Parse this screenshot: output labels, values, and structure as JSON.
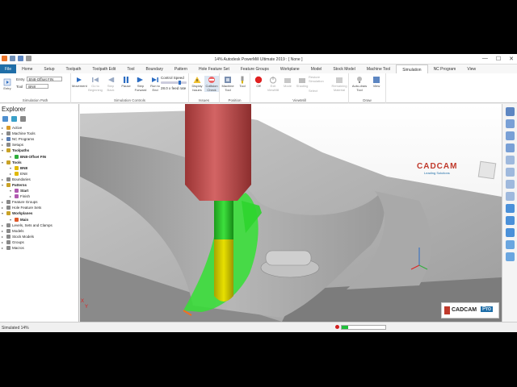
{
  "window": {
    "title": "14% Autodesk PowerMill Ultimate 2019  :  [ None ]"
  },
  "tabs": [
    "File",
    "Home",
    "Setup",
    "Toolpath",
    "Toolpath Edit",
    "Tool",
    "Boundary",
    "Pattern",
    "Hole Feature Set",
    "Feature Groups",
    "Workplane",
    "Model",
    "Stock Model",
    "Machine Tool",
    "Simulation",
    "NC Program",
    "View"
  ],
  "active_tab": "Simulation",
  "ribbon": {
    "simulation_path": {
      "entry_label": "Entry",
      "entry_value": "BN8-Offset FIN",
      "tool_label": "Tool",
      "tool_value": "BN8",
      "entry_btn": "Entry",
      "group_label": "Simulation Path"
    },
    "simulation_controls": {
      "movement": "Movement",
      "go_to_beginning": "Go to Beginning",
      "step_back": "Step Back",
      "pause": "Pause",
      "step_forward": "Step Forward",
      "run_to_end": "Run to End",
      "control_speed": "Control Speed",
      "feed_rate": "28.0 x feed rate",
      "group_label": "Simulation Controls"
    },
    "issues": {
      "display_issues": "Display Issues",
      "collision_check": "Collision Check",
      "group_label": "Issues"
    },
    "position": {
      "machine_tool": "Machine Tool",
      "tool": "Tool",
      "group_label": "Position"
    },
    "viewmill": {
      "off": "Off",
      "exit_viewmill": "Exit ViewMill",
      "mode": "Mode",
      "shading": "Shading",
      "restore_simulation": "Restore Simulation",
      "select": "Select",
      "remaining_material": "Remaining Material",
      "group_label": "ViewMill"
    },
    "draw": {
      "auto_draw_tool": "Auto-draw Tool",
      "view": "View",
      "group_label": "Draw"
    }
  },
  "explorer": {
    "title": "Explorer",
    "items": [
      {
        "label": "Active",
        "indent": 0,
        "bold": false,
        "color": "#d89a2a"
      },
      {
        "label": "Machine Tools",
        "indent": 0,
        "bold": false,
        "color": "#8a8a8a"
      },
      {
        "label": "NC Programs",
        "indent": 0,
        "bold": false,
        "color": "#5a7fb5"
      },
      {
        "label": "Setups",
        "indent": 0,
        "bold": false,
        "color": "#8a8a8a"
      },
      {
        "label": "Toolpaths",
        "indent": 0,
        "bold": true,
        "color": "#c9a227"
      },
      {
        "label": "BN8-Offset FIN",
        "indent": 1,
        "bold": true,
        "color": "#2fae3b"
      },
      {
        "label": "Tools",
        "indent": 0,
        "bold": true,
        "color": "#c9a227"
      },
      {
        "label": "BN8",
        "indent": 1,
        "bold": true,
        "color": "#e0b800"
      },
      {
        "label": "EN8",
        "indent": 1,
        "bold": false,
        "color": "#e0b800"
      },
      {
        "label": "Boundaries",
        "indent": 0,
        "bold": false,
        "color": "#8a8a8a"
      },
      {
        "label": "Patterns",
        "indent": 0,
        "bold": true,
        "color": "#c9a227"
      },
      {
        "label": "Start",
        "indent": 1,
        "bold": true,
        "color": "#b05ab0"
      },
      {
        "label": "Finish",
        "indent": 1,
        "bold": false,
        "color": "#b05ab0"
      },
      {
        "label": "Feature Groups",
        "indent": 0,
        "bold": false,
        "color": "#8a8a8a"
      },
      {
        "label": "Hole Feature Sets",
        "indent": 0,
        "bold": false,
        "color": "#8a8a8a"
      },
      {
        "label": "Workplanes",
        "indent": 0,
        "bold": true,
        "color": "#c9a227"
      },
      {
        "label": "Main",
        "indent": 1,
        "bold": true,
        "color": "#e05a2a"
      },
      {
        "label": "Levels, Sets and Clamps",
        "indent": 0,
        "bold": false,
        "color": "#8a8a8a"
      },
      {
        "label": "Models",
        "indent": 0,
        "bold": false,
        "color": "#8a8a8a"
      },
      {
        "label": "Stock Models",
        "indent": 0,
        "bold": false,
        "color": "#8a8a8a"
      },
      {
        "label": "Groups",
        "indent": 0,
        "bold": false,
        "color": "#8a8a8a"
      },
      {
        "label": "Macros",
        "indent": 0,
        "bold": false,
        "color": "#8a8a8a"
      }
    ]
  },
  "viewport": {
    "logo_top": "CADCAM",
    "logo_sub": "Leading Solutions",
    "logo_bottom": "CADCAM",
    "logo_bottom_pro": "Pro",
    "axis_z": "Z",
    "axis_x": "X",
    "axis_y": "Y"
  },
  "status": {
    "text": "Simulated 14%",
    "progress": 0.14
  },
  "colors": {
    "accent": "#1f6ea8",
    "progress": "#1fbf3a",
    "toolpath": "#22e02a",
    "spindle": "#c74b4b"
  }
}
